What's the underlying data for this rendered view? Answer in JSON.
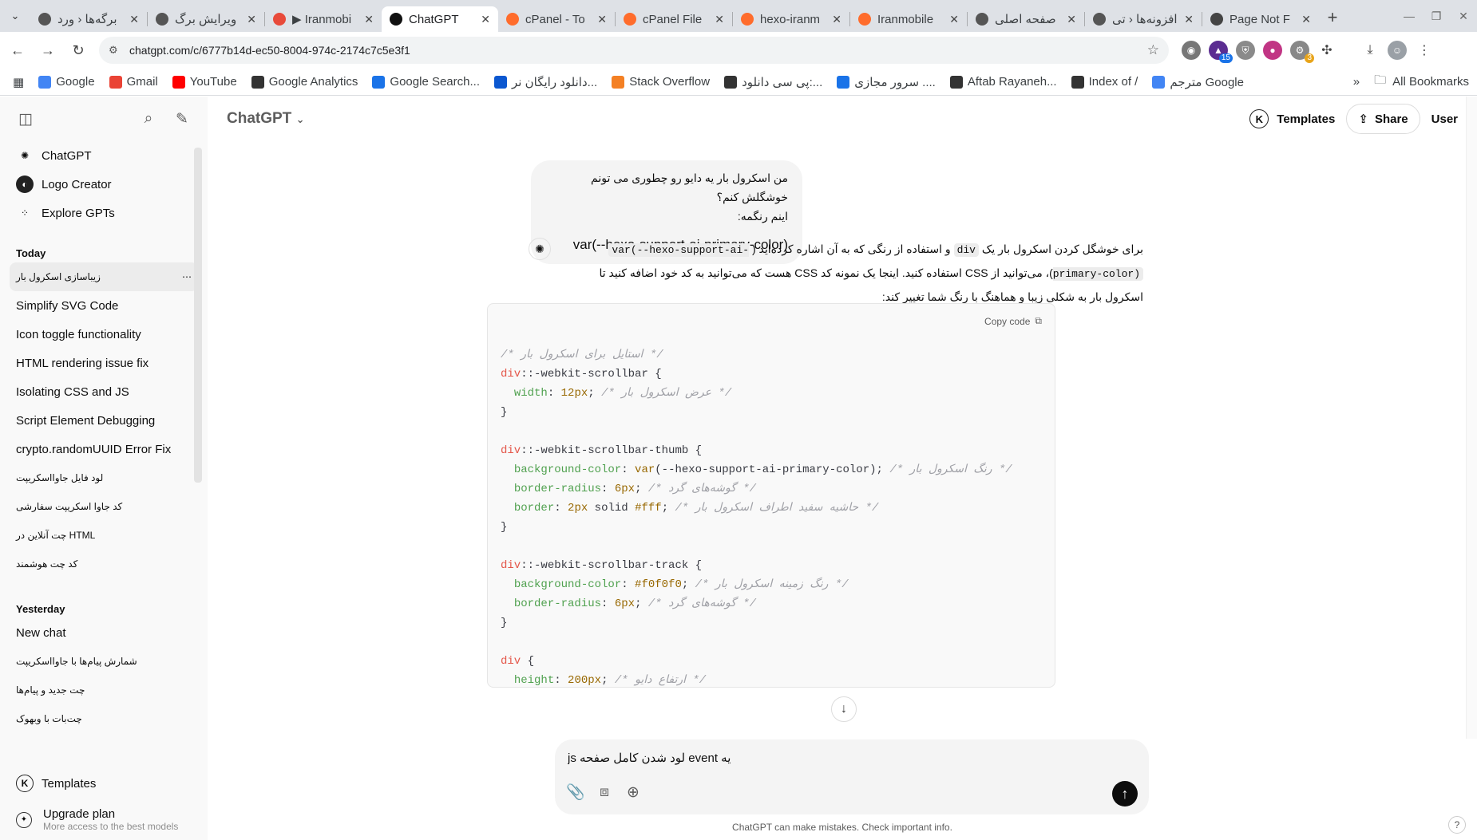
{
  "browser": {
    "tabs": [
      {
        "title": "برگه‌ها ‹ ورد",
        "color": "#555"
      },
      {
        "title": "ویرایش برگ",
        "color": "#555"
      },
      {
        "title": "▶ Iranmobi",
        "color": "#e84a3a"
      },
      {
        "title": "ChatGPT",
        "color": "#111"
      },
      {
        "title": "cPanel - To",
        "color": "#ff6c2c"
      },
      {
        "title": "cPanel File",
        "color": "#ff6c2c"
      },
      {
        "title": "hexo-iranm",
        "color": "#ff6c2c"
      },
      {
        "title": "Iranmobile",
        "color": "#ff6c2c"
      },
      {
        "title": "صفحه اصلی",
        "color": "#555"
      },
      {
        "title": "افزونه‌ها ‹ تی",
        "color": "#555"
      },
      {
        "title": "Page Not F",
        "color": "#444"
      }
    ],
    "active_tab": 3,
    "url": "chatgpt.com/c/6777b14d-ec50-8004-974c-2174c7c5e3f1",
    "extension_badges": [
      "15",
      "3"
    ],
    "bookmarks": [
      {
        "label": "Google",
        "color": "#4285f4"
      },
      {
        "label": "Gmail",
        "color": "#ea4335"
      },
      {
        "label": "YouTube",
        "color": "#ff0000"
      },
      {
        "label": "Google Analytics",
        "color": "#333"
      },
      {
        "label": "Google Search...",
        "color": "#1a73e8"
      },
      {
        "label": "دانلود رایگان نر...",
        "color": "#0b57d0"
      },
      {
        "label": "Stack Overflow",
        "color": "#f48024"
      },
      {
        "label": "پی سی دانلود:...",
        "color": "#333"
      },
      {
        "label": "سرور مجازی ....",
        "color": "#1a73e8"
      },
      {
        "label": "Aftab Rayaneh...",
        "color": "#333"
      },
      {
        "label": "Index of /",
        "color": "#333"
      },
      {
        "label": "مترجم Google",
        "color": "#4285f4"
      }
    ],
    "all_bookmarks": "All Bookmarks"
  },
  "sidebar": {
    "nav": [
      {
        "label": "ChatGPT",
        "icon": "chatgpt-icon"
      },
      {
        "label": "Logo Creator",
        "icon": "logo-creator-icon"
      },
      {
        "label": "Explore GPTs",
        "icon": "grid-icon"
      }
    ],
    "today_label": "Today",
    "today": [
      "زیباسازی اسکرول بار",
      "Simplify SVG Code",
      "Icon toggle functionality",
      "HTML rendering issue fix",
      "Isolating CSS and JS",
      "Script Element Debugging",
      "crypto.randomUUID Error Fix",
      "لود فایل جاوااسکریپت",
      "کد جاوا اسکریپت سفارشی",
      "چت آنلاین در HTML",
      "کد چت هوشمند"
    ],
    "yesterday_label": "Yesterday",
    "yesterday": [
      "New chat",
      "شمارش پیام‌ها با جاوااسکریپت",
      "چت جدید و پیام‌ها",
      "چت‌بات با وبهوک"
    ],
    "templates": "Templates",
    "upgrade_title": "Upgrade plan",
    "upgrade_sub": "More access to the best models"
  },
  "header": {
    "model": "ChatGPT",
    "templates": "Templates",
    "share": "Share",
    "user": "User"
  },
  "conversation": {
    "user_line1": "من اسکرول بار یه دایو رو چطوری می تونم خوشگلش کنم؟",
    "user_line2": "اینم رنگمه:",
    "user_code": "var(--hexo-support-ai-primary-color)",
    "ai_p1": "برای خوشگل کردن اسکرول بار یک",
    "ai_code1": "div",
    "ai_p2": "و استفاده از رنگی که به آن اشاره کرده‌اید (",
    "ai_code2": "var(--hexo-support-ai-primary-color)",
    "ai_p3": ")، می‌توانید از CSS استفاده کنید. اینجا یک نمونه کد CSS هست که می‌توانید به کد خود اضافه کنید تا اسکرول بار به شکلی زیبا و هماهنگ با رنگ شما تغییر کند:",
    "copy_code": "Copy code"
  },
  "composer": {
    "value": "یه event لود شدن کامل صفحه js"
  },
  "footer": "ChatGPT can make mistakes. Check important info."
}
